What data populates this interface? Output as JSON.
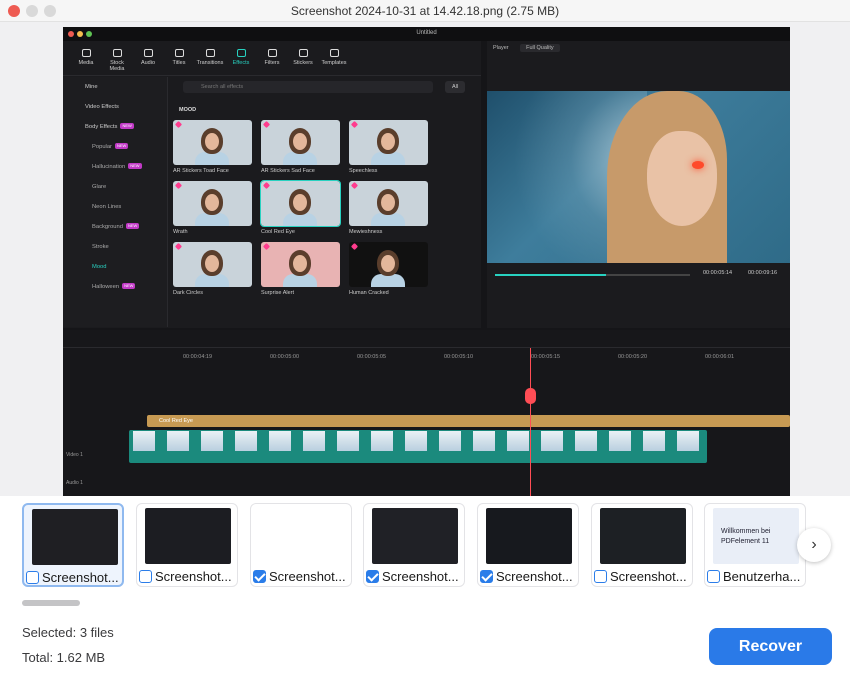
{
  "window": {
    "title": "Screenshot 2024-10-31 at 14.42.18.png (2.75 MB)"
  },
  "preview": {
    "app_title": "Untitled",
    "toolbar": [
      "Media",
      "Stock Media",
      "Audio",
      "Titles",
      "Transitions",
      "Effects",
      "Filters",
      "Stickers",
      "Templates"
    ],
    "active_tool": "Effects",
    "sidebar": [
      {
        "label": "Mine",
        "level": 0
      },
      {
        "label": "Video Effects",
        "level": 0
      },
      {
        "label": "Body Effects",
        "level": 0,
        "badge": "NEW"
      },
      {
        "label": "Popular",
        "level": 1,
        "badge": "NEW"
      },
      {
        "label": "Hallucination",
        "level": 1,
        "badge": "NEW"
      },
      {
        "label": "Glare",
        "level": 1
      },
      {
        "label": "Neon Lines",
        "level": 1
      },
      {
        "label": "Background",
        "level": 1,
        "badge": "NEW"
      },
      {
        "label": "Stroke",
        "level": 1
      },
      {
        "label": "Mood",
        "level": 1,
        "selected": true
      },
      {
        "label": "Halloween",
        "level": 1,
        "badge": "NEW"
      }
    ],
    "search_placeholder": "Search all effects",
    "filter": "All",
    "section": "MOOD",
    "effects": [
      "AR Stickers Toad Face",
      "AR Stickers Sad Face",
      "Speechless",
      "Wrath",
      "Cool Red Eye",
      "Mewieshness",
      "Dark Circles",
      "Surprise Alert",
      "Human Cracked"
    ],
    "player": {
      "label": "Player",
      "quality": "Full Quality",
      "time_current": "00:00:05:14",
      "time_total": "00:00:09:16",
      "progress": 0.57
    },
    "ruler": [
      "00:00:04:19",
      "00:00:05:00",
      "00:00:05:05",
      "00:00:05:10",
      "00:00:05:15",
      "00:00:05:20",
      "00:00:06:01"
    ],
    "track_effect_label": "Cool Red Eye",
    "track_video_label": "Video 1",
    "track_audio_label": "Audio 1"
  },
  "thumbnails": [
    {
      "name": "Screenshot...",
      "checked": false,
      "active": true
    },
    {
      "name": "Screenshot...",
      "checked": false,
      "active": false
    },
    {
      "name": "Screenshot...",
      "checked": true,
      "active": false
    },
    {
      "name": "Screenshot...",
      "checked": true,
      "active": false
    },
    {
      "name": "Screenshot...",
      "checked": true,
      "active": false
    },
    {
      "name": "Screenshot...",
      "checked": false,
      "active": false
    },
    {
      "name": "Benutzerha...",
      "checked": false,
      "active": false
    }
  ],
  "pdf_thumb": {
    "line1": "Willkommen bei",
    "line2": "PDFelement 11"
  },
  "summary": {
    "selected": "Selected: 3 files",
    "total": "Total: 1.62 MB"
  },
  "recover_label": "Recover",
  "colors": {
    "accent": "#2a7ae8",
    "teal": "#28d1c0",
    "playhead": "#ff4d55"
  }
}
